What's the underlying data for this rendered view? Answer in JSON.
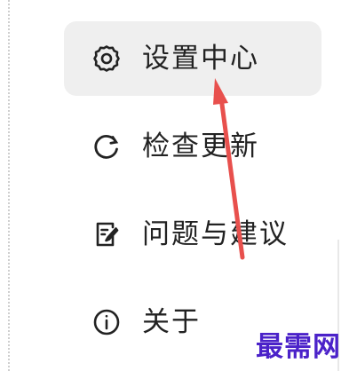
{
  "menu": {
    "items": [
      {
        "label": "设置中心",
        "icon": "gear-icon",
        "active": true
      },
      {
        "label": "检查更新",
        "icon": "refresh-icon",
        "active": false
      },
      {
        "label": "问题与建议",
        "icon": "feedback-edit-icon",
        "active": false
      },
      {
        "label": "关于",
        "icon": "info-icon",
        "active": false
      }
    ]
  },
  "annotation": {
    "arrow_color": "#e8504d"
  },
  "watermark": {
    "text": "最需网",
    "color": "#4b22c9"
  },
  "colors": {
    "active_background": "#efefef",
    "text": "#222222"
  }
}
